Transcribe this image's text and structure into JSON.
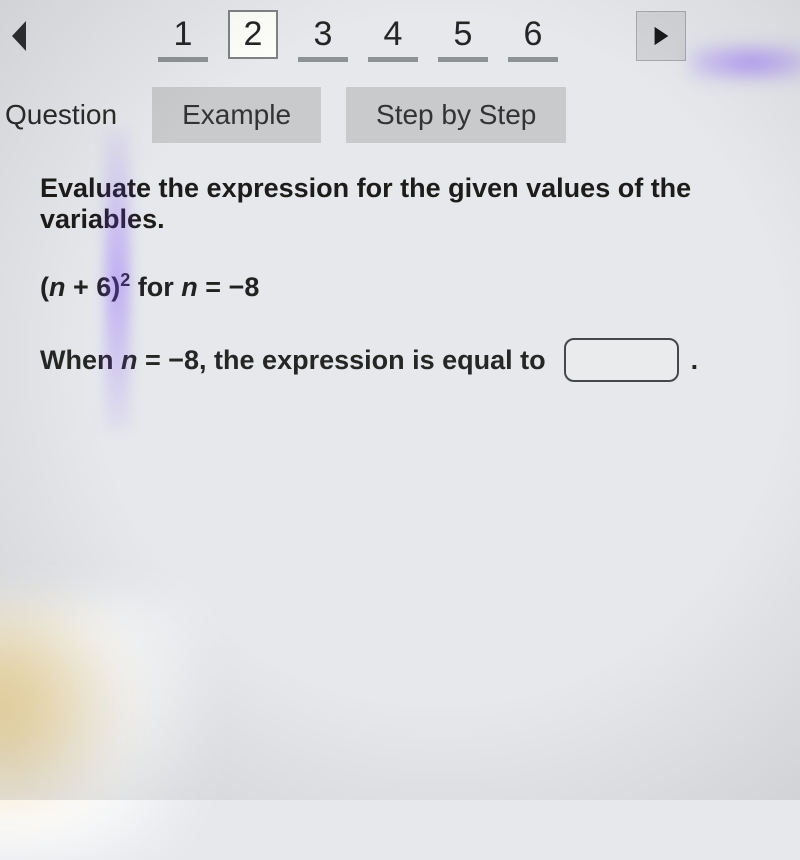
{
  "nav": {
    "pages": [
      "1",
      "2",
      "3",
      "4",
      "5",
      "6"
    ],
    "active_index": 1
  },
  "tabs": {
    "question": "Question",
    "example": "Example",
    "step_by_step": "Step by Step"
  },
  "question": {
    "prompt": "Evaluate the expression for the given values of the variables.",
    "expr_left": "(",
    "expr_var1": "n",
    "expr_mid": " + 6)",
    "expr_exp": "2",
    "expr_for": " for ",
    "expr_var2": "n",
    "expr_eq": " = −8",
    "ans_when": "When ",
    "ans_var": "n",
    "ans_mid": " = −8, the expression is equal to",
    "ans_period": "."
  }
}
